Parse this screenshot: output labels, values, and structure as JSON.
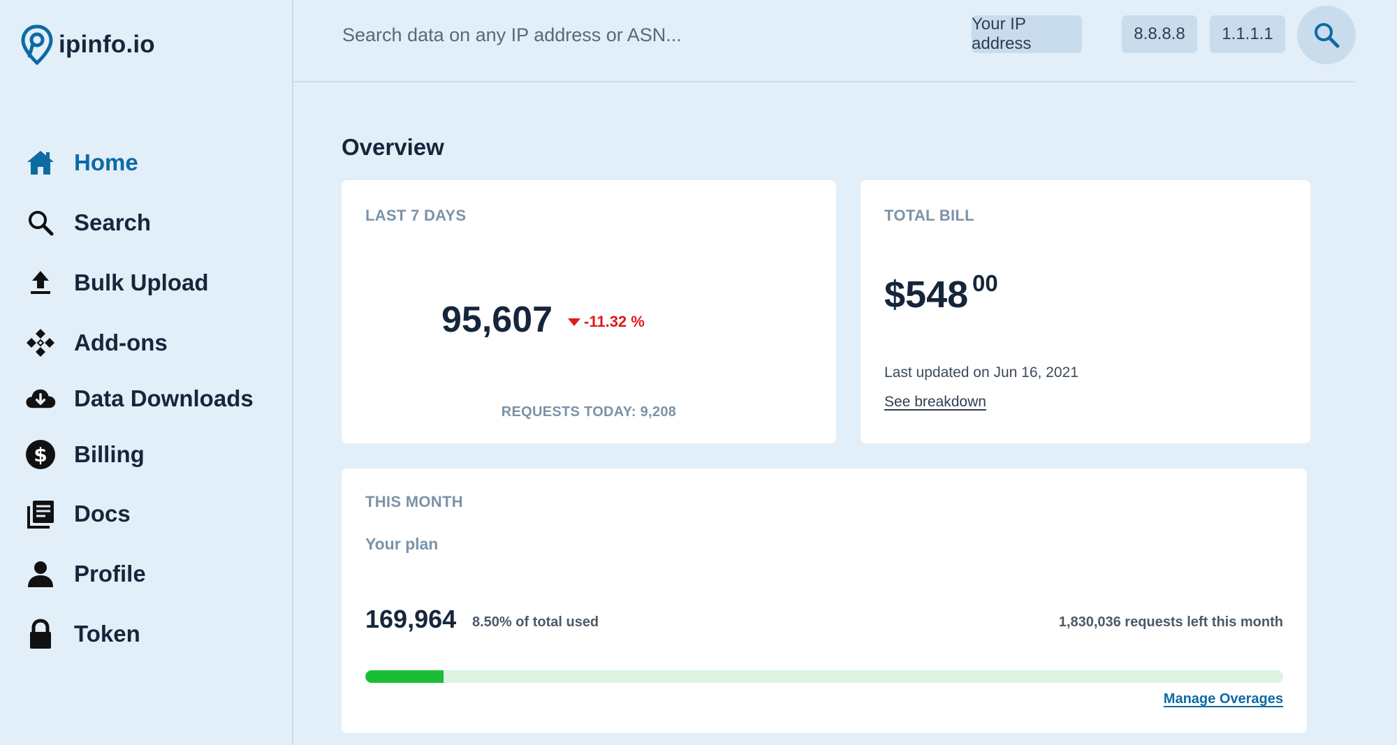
{
  "brand": {
    "name": "ipinfo.io",
    "accent": "#0d6aa3"
  },
  "sidebar": {
    "items": [
      {
        "label": "Home",
        "icon": "home-icon",
        "active": true
      },
      {
        "label": "Search",
        "icon": "search-icon"
      },
      {
        "label": "Bulk Upload",
        "icon": "upload-icon"
      },
      {
        "label": "Add-ons",
        "icon": "addons-icon"
      },
      {
        "label": "Data Downloads",
        "icon": "cloud-download-icon"
      },
      {
        "label": "Billing",
        "icon": "dollar-icon"
      },
      {
        "label": "Docs",
        "icon": "docs-icon"
      },
      {
        "label": "Profile",
        "icon": "user-icon"
      },
      {
        "label": "Token",
        "icon": "lock-icon"
      }
    ]
  },
  "header": {
    "search_placeholder": "Search data on any IP address or ASN...",
    "chips": [
      "Your IP address",
      "8.8.8.8",
      "1.1.1.1"
    ]
  },
  "main": {
    "title": "Overview",
    "last7": {
      "label": "LAST 7 DAYS",
      "value": "95,607",
      "delta": "-11.32 %",
      "requests_today": "REQUESTS TODAY: 9,208"
    },
    "bill": {
      "label": "TOTAL BILL",
      "amount": "$548",
      "cents": "00",
      "updated": "Last updated on Jun 16, 2021",
      "breakdown_link": "See breakdown"
    },
    "month": {
      "label": "THIS MONTH",
      "plan_label": "Your plan",
      "used": "169,964",
      "used_pct": "8.50% of total used",
      "left": "1,830,036 requests left this month",
      "progress_fraction": 0.085,
      "manage_link": "Manage Overages"
    }
  }
}
